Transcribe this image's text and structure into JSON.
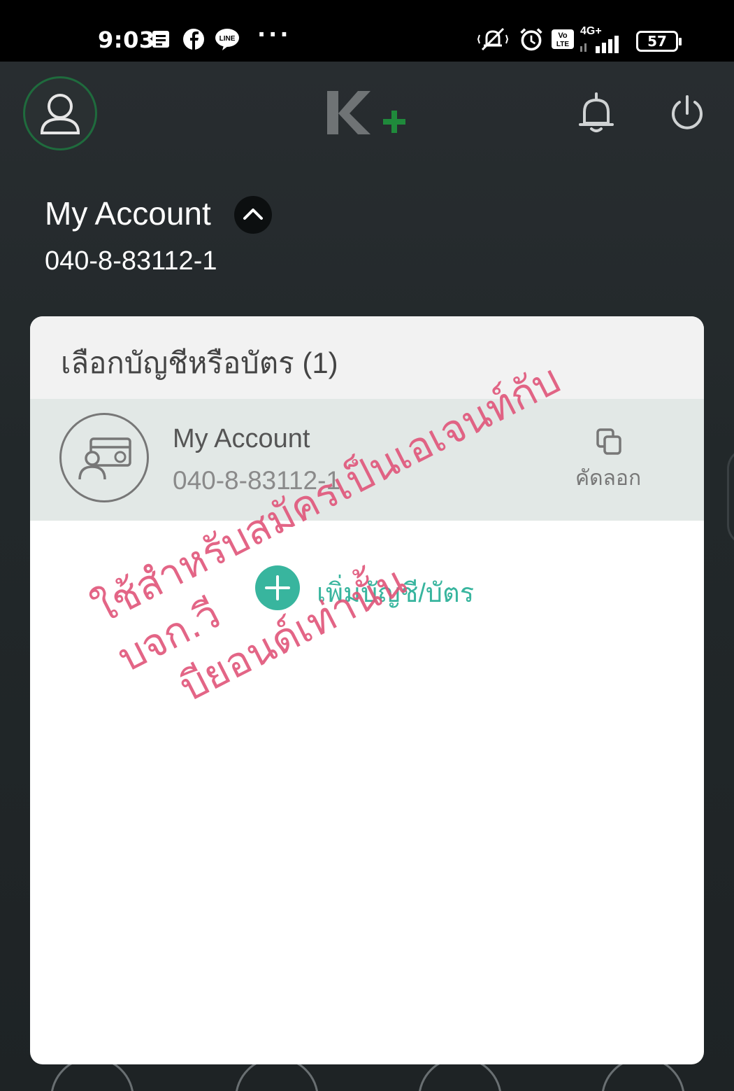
{
  "status_bar": {
    "time": "9:03",
    "icons": [
      "message-icon",
      "facebook-icon",
      "line-icon",
      "more-dots-icon",
      "vibrate-off-icon",
      "alarm-icon",
      "volte-icon",
      "signal-4g-icon"
    ],
    "network": "4G+",
    "volte": "Vo LTE",
    "dots": "···",
    "battery": "57"
  },
  "header": {
    "logo_text": "K+",
    "logo_colors": {
      "k": "#6f7375",
      "plus": "#1f8a3b"
    }
  },
  "account": {
    "name": "My Account",
    "number": "040-8-83112-1"
  },
  "panel": {
    "title": "เลือกบัญชีหรือบัตร (1)",
    "items": [
      {
        "name": "My Account",
        "number": "040-8-83112-1",
        "action_label": "คัดลอก"
      }
    ],
    "add_label": "เพิ่มบัญชี/บัตร"
  },
  "watermark": {
    "line1": "ใช้สำหรับสมัครเป็นเอเจนท์กับ บจก.วี",
    "line2": "บียอนด์เท่านั้น"
  },
  "colors": {
    "accent": "#38b59e",
    "watermark": "#e0557a",
    "avatar_ring": "#1f6b3d"
  }
}
